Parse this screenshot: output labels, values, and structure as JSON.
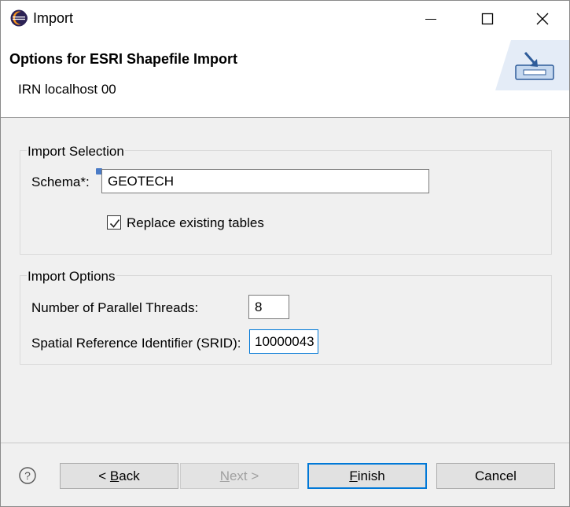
{
  "window": {
    "title": "Import",
    "controls": {
      "minimize": "minimize-icon",
      "maximize": "maximize-icon",
      "close": "close-icon"
    }
  },
  "header": {
    "title": "Options for ESRI Shapefile Import",
    "subtitle": "IRN localhost 00"
  },
  "import_selection": {
    "group_title": "Import Selection",
    "schema_label": "Schema*:",
    "schema_value": "GEOTECH",
    "replace_label": "Replace existing tables",
    "replace_checked": true
  },
  "import_options": {
    "group_title": "Import Options",
    "threads_label": "Number of Parallel Threads:",
    "threads_value": "8",
    "srid_label": "Spatial Reference Identifier (SRID):",
    "srid_value": "10000043"
  },
  "footer": {
    "back_prefix": "< ",
    "back_mnemonic": "B",
    "back_rest": "ack",
    "next_mnemonic": "N",
    "next_rest": "ext >",
    "finish_mnemonic": "F",
    "finish_rest": "inish",
    "cancel_label": "Cancel",
    "help_icon": "help-icon"
  },
  "colors": {
    "accent": "#0078d7"
  }
}
